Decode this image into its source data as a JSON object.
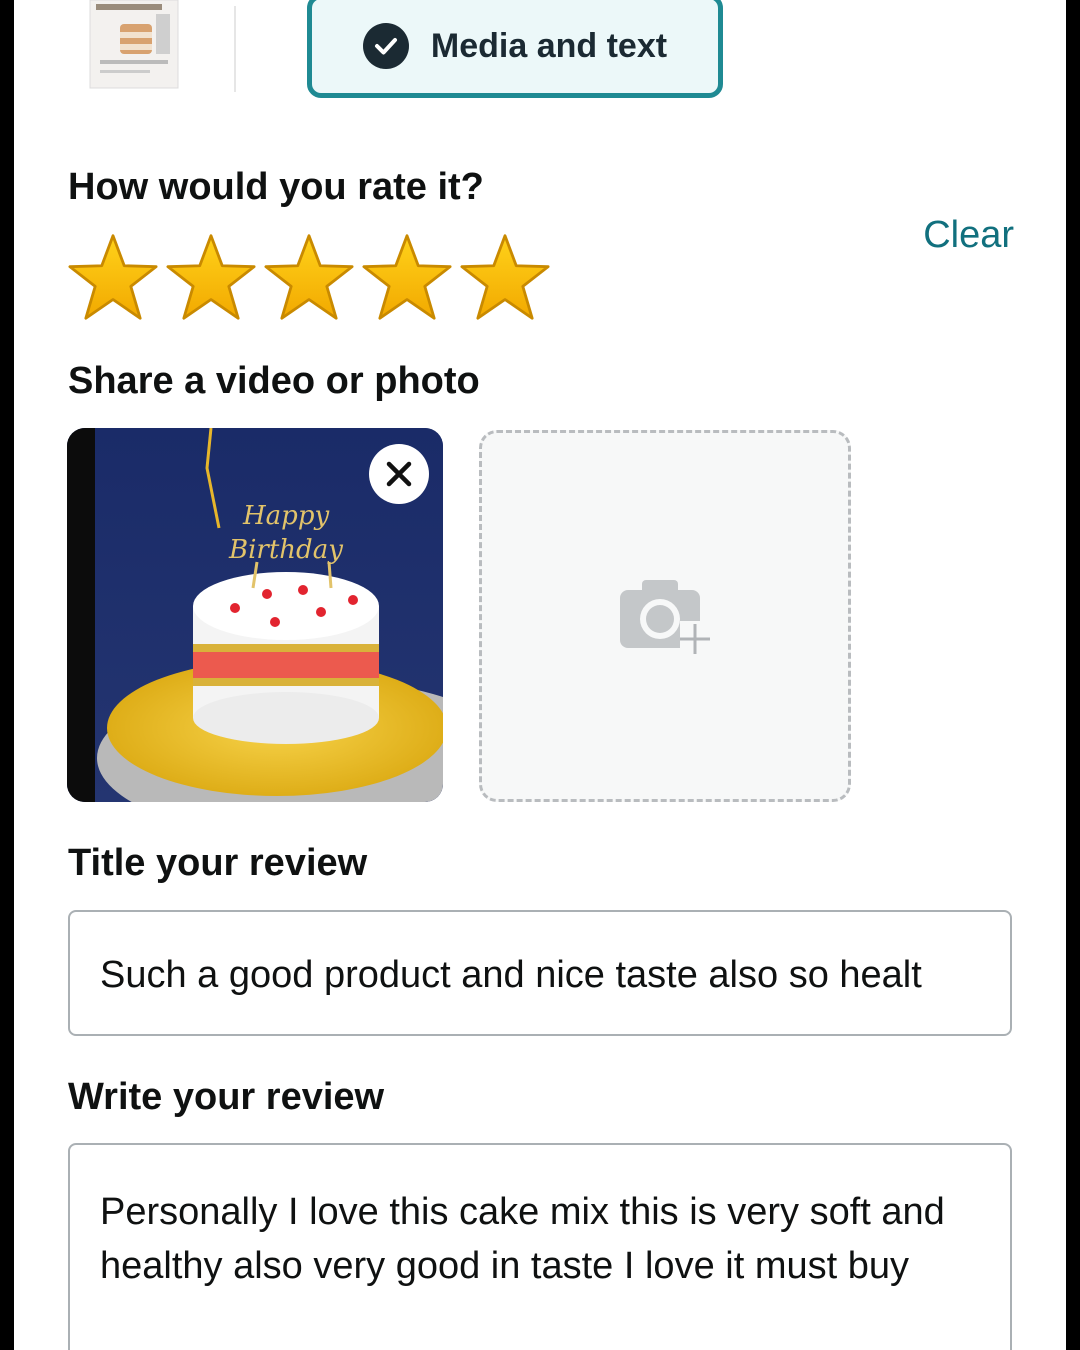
{
  "mode_chip": {
    "label": "Media and text",
    "selected": true
  },
  "rating": {
    "heading": "How would you rate it?",
    "clear_label": "Clear",
    "value": 5,
    "max": 5,
    "star_color": "#f5b700"
  },
  "media": {
    "heading": "Share a video or photo",
    "uploaded_photo_icon": "birthday-cake-photo",
    "remove_icon": "close-icon",
    "add_icon": "camera-add-icon"
  },
  "title_field": {
    "heading": "Title your review",
    "value": "Such a good product and nice taste also so healt"
  },
  "review_field": {
    "heading": "Write your review",
    "value": "Personally I love this cake mix this is very soft and healthy  also very good in taste I love it must buy"
  },
  "colors": {
    "accent": "#1f8a93",
    "link": "#11707e",
    "text": "#0f1111"
  }
}
